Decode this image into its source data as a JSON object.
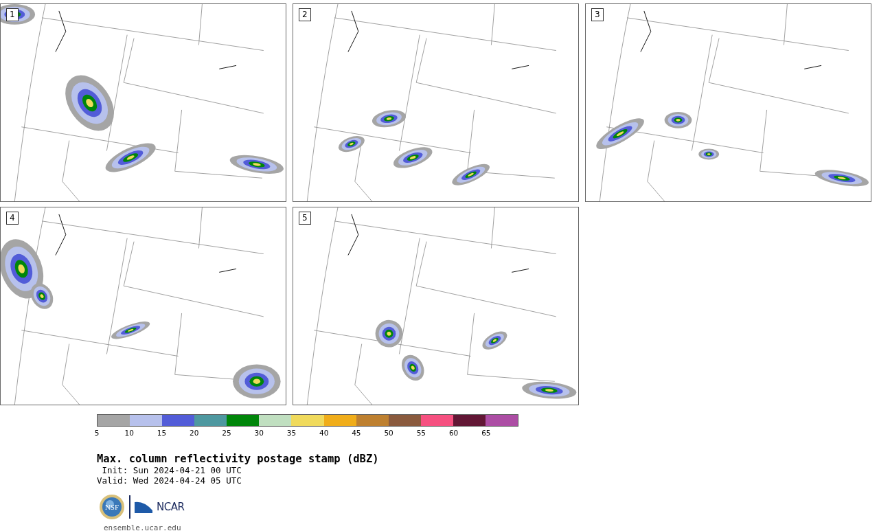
{
  "panels": [
    {
      "label": "1"
    },
    {
      "label": "2"
    },
    {
      "label": "3"
    },
    {
      "label": "4"
    },
    {
      "label": "5"
    }
  ],
  "legend": [
    {
      "label": "5",
      "color": "#a5a5a5"
    },
    {
      "label": "10",
      "color": "#b7c1ec"
    },
    {
      "label": "15",
      "color": "#525cd8"
    },
    {
      "label": "20",
      "color": "#4e98a0"
    },
    {
      "label": "25",
      "color": "#00860a"
    },
    {
      "label": "30",
      "color": "#c0dfc0"
    },
    {
      "label": "35",
      "color": "#f0da5c"
    },
    {
      "label": "40",
      "color": "#f0ad1a"
    },
    {
      "label": "45",
      "color": "#be8030"
    },
    {
      "label": "50",
      "color": "#8a5a3e"
    },
    {
      "label": "55",
      "color": "#f65080"
    },
    {
      "label": "60",
      "color": "#621735"
    },
    {
      "label": "65",
      "color": "#ac4da4"
    }
  ],
  "title": "Max. column reflectivity postage stamp (dBZ)",
  "init": " Init: Sun 2024-04-21 00 UTC",
  "valid": "Valid: Wed 2024-04-24 05 UTC",
  "logo": {
    "seal_text": "NSF",
    "wordmark": "NCAR"
  },
  "footer": "ensemble.ucar.edu"
}
